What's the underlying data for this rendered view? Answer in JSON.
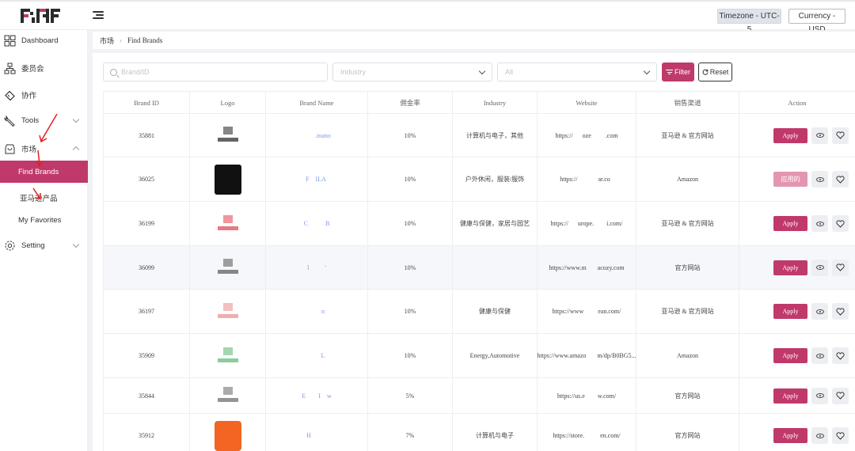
{
  "header": {
    "timezone_label": "Timezone - UTC-5",
    "currency_label": "Currency - USD"
  },
  "sidebar": {
    "items": [
      {
        "label": "Dashboard",
        "icon": "dashboard-icon"
      },
      {
        "label": "委员会",
        "icon": "org-chart-icon"
      },
      {
        "label": "协作",
        "icon": "handshake-icon"
      },
      {
        "label": "Tools",
        "icon": "tools-icon"
      },
      {
        "label": "市场",
        "icon": "market-icon"
      },
      {
        "label": "Find Brands",
        "icon": ""
      },
      {
        "label": "亚马逊产品",
        "icon": ""
      },
      {
        "label": "My Favorites",
        "icon": ""
      },
      {
        "label": "Setting",
        "icon": "gear-icon"
      }
    ]
  },
  "breadcrumb": {
    "parent": "市场",
    "current": "Find Brands"
  },
  "filters": {
    "search_placeholder": "Brand/ID",
    "industry_placeholder": "Industry",
    "all_placeholder": "All",
    "filter_label": "Filter",
    "reset_label": "Reset"
  },
  "table": {
    "columns": [
      "Brand ID",
      "Logo",
      "Brand Name",
      "佣金率",
      "Industry",
      "Website",
      "销售渠道",
      "Action"
    ],
    "rows": [
      {
        "id": "35881",
        "name": "        .mano",
        "rate": "10%",
        "industry": "计算机与电子，其他",
        "website": "https://      oze         .com",
        "channel": "亚马逊 & 官方网站",
        "action": "Apply",
        "applied": false,
        "logo_color": "#222222"
      },
      {
        "id": "36025",
        "name": "F    ILA ",
        "rate": "10%",
        "industry": "户外休闲，服装/服饰",
        "website": "https://             ar.co  ",
        "channel": "Amazon",
        "action": "应用的",
        "applied": true,
        "logo_color": "#111111"
      },
      {
        "id": "36199",
        "name": "C           B",
        "rate": "10%",
        "industry": "健康与保健，家居与园艺",
        "website": "https://      urope.        i.com/",
        "channel": "亚马逊 & 官方网站",
        "action": "Apply",
        "applied": false,
        "logo_color": "#e0404a"
      },
      {
        "id": "36099",
        "name": "l          '",
        "rate": "10%",
        "industry": "",
        "website": "https://www.m       acozy.com",
        "channel": "官方网站",
        "action": "Apply",
        "applied": false,
        "logo_color": "#555555"
      },
      {
        "id": "36197",
        "name": "        n",
        "rate": "10%",
        "industry": "健康与保健",
        "website": "https://www         ean.com/",
        "channel": "亚马逊 & 官方网站",
        "action": "Apply",
        "applied": false,
        "logo_color": "#e88a90"
      },
      {
        "id": "35909",
        "name": "        L",
        "rate": "10%",
        "industry": "Energy,Automotive",
        "website": "https://www.amazo       m/dp/B0BG5...",
        "channel": "Amazon",
        "action": "Apply",
        "applied": false,
        "logo_color": "#56b870"
      },
      {
        "id": "35844",
        "name": "E        I    w",
        "rate": "5%",
        "industry": "",
        "website": "https://us.e        w.com/",
        "channel": "官方网站",
        "action": "Apply",
        "applied": false,
        "logo_color": "#666666"
      },
      {
        "id": "35912",
        "name": "H          ",
        "rate": "7%",
        "industry": "计算机与电子",
        "website": "https://store.          en.com/",
        "channel": "官方网站",
        "action": "Apply",
        "applied": false,
        "logo_color": "#f26522"
      }
    ]
  },
  "colors": {
    "accent": "#c0396b",
    "accent_light": "#e396b1",
    "link": "#7b9ae8"
  }
}
